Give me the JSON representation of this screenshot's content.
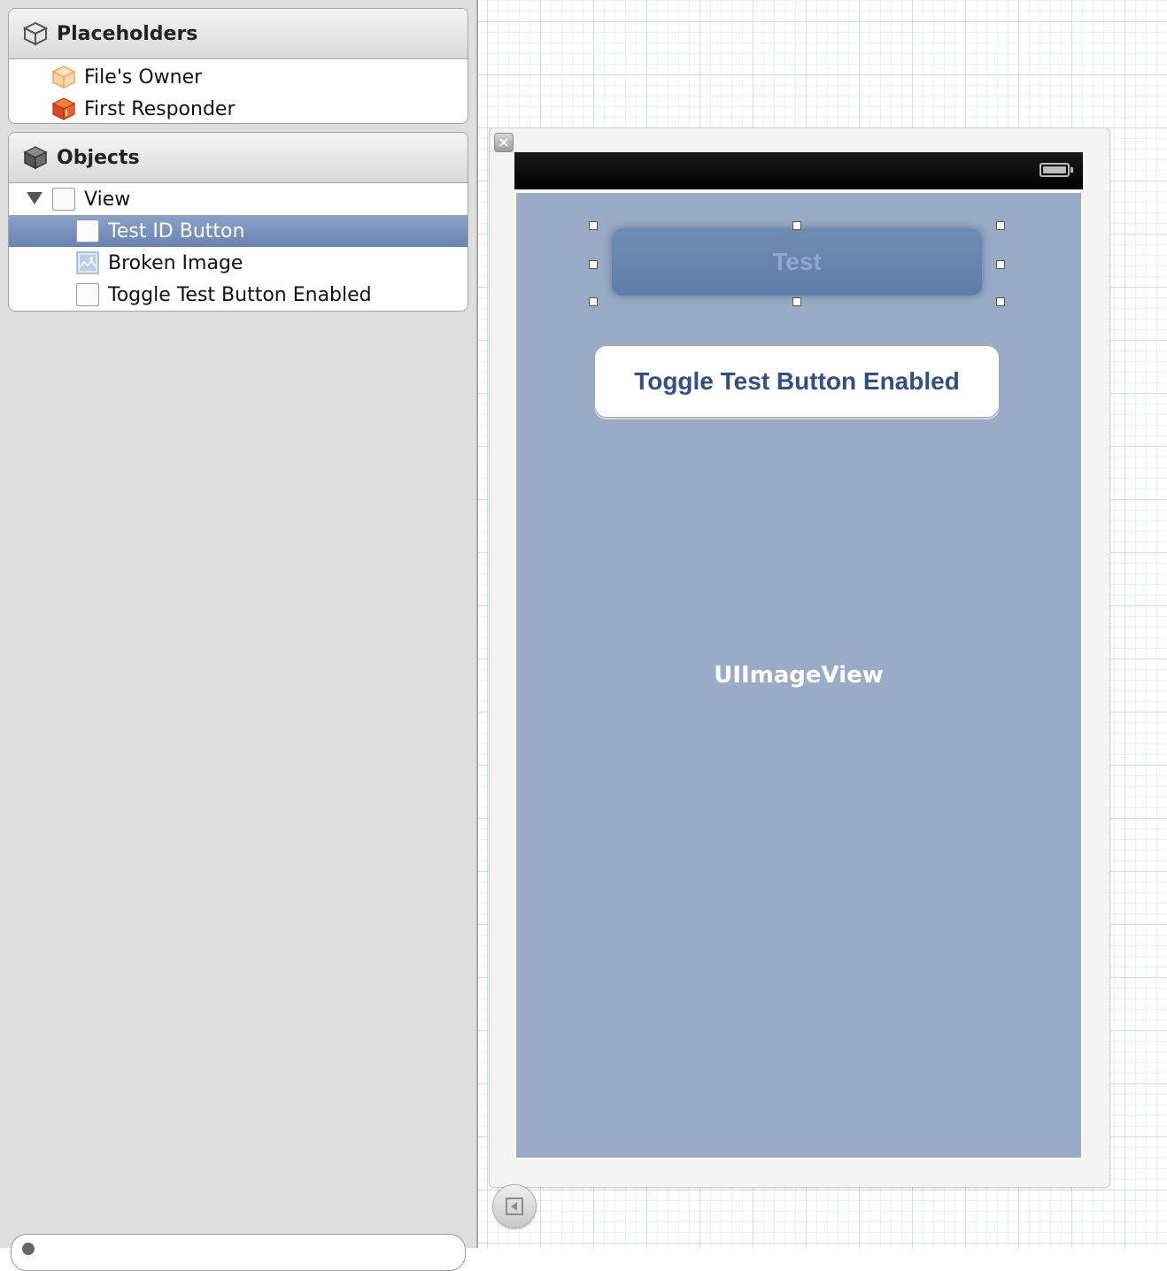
{
  "outline": {
    "placeholders": {
      "title": "Placeholders",
      "items": [
        {
          "label": "File's Owner",
          "icon": "files-owner-cube-icon"
        },
        {
          "label": "First Responder",
          "icon": "first-responder-cube-icon"
        }
      ]
    },
    "objects": {
      "title": "Objects",
      "view": {
        "label": "View",
        "expanded": true
      },
      "children": [
        {
          "label": "Test ID Button",
          "icon": "button-placeholder-icon",
          "selected": true
        },
        {
          "label": "Broken Image",
          "icon": "image-view-icon",
          "selected": false
        },
        {
          "label": "Toggle Test Button Enabled",
          "icon": "button-placeholder-icon",
          "selected": false
        }
      ]
    }
  },
  "canvas": {
    "test_button_label": "Test",
    "toggle_button_label": "Toggle Test Button Enabled",
    "image_view_label": "UIImageView"
  },
  "colors": {
    "selection": "#6f89b8",
    "view_background": "#9aacc5",
    "status_bar": "#000000",
    "toggle_text": "#324f85"
  }
}
